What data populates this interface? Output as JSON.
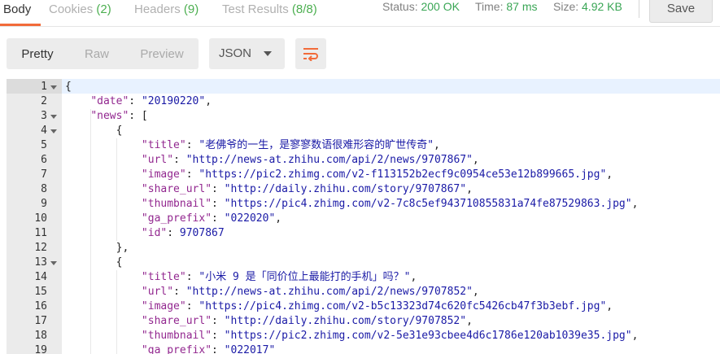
{
  "tabs": [
    {
      "label": "Body",
      "count": ""
    },
    {
      "label": "Cookies",
      "count": "(2)"
    },
    {
      "label": "Headers",
      "count": "(9)"
    },
    {
      "label": "Test Results",
      "count": "(8/8)"
    }
  ],
  "status": {
    "status_label": "Status:",
    "status_value": "200 OK",
    "time_label": "Time:",
    "time_value": "87 ms",
    "size_label": "Size:",
    "size_value": "4.92 KB"
  },
  "save_label": "Save",
  "view_modes": [
    "Pretty",
    "Raw",
    "Preview"
  ],
  "format_select": "JSON",
  "icons": {
    "wrap": "wrap-lines-icon",
    "fold": "fold-arrow-icon"
  },
  "colors": {
    "accent": "#f26b3a",
    "success": "#3aa655",
    "json_key": "#92278f",
    "json_string": "#1a1aa6"
  },
  "code": {
    "line_numbers": [
      "1",
      "2",
      "3",
      "4",
      "5",
      "6",
      "7",
      "8",
      "9",
      "10",
      "11",
      "12",
      "13",
      "14",
      "15",
      "16",
      "17",
      "18",
      "19"
    ],
    "foldable_lines": [
      "1",
      "3",
      "4",
      "13"
    ],
    "lines": [
      {
        "indent": "",
        "parts": [
          {
            "t": "pun",
            "v": "{"
          }
        ]
      },
      {
        "indent": "    ",
        "parts": [
          {
            "t": "key",
            "v": "\"date\""
          },
          {
            "t": "pun",
            "v": ": "
          },
          {
            "t": "str",
            "v": "\"20190220\""
          },
          {
            "t": "pun",
            "v": ","
          }
        ]
      },
      {
        "indent": "    ",
        "parts": [
          {
            "t": "key",
            "v": "\"news\""
          },
          {
            "t": "pun",
            "v": ": ["
          }
        ]
      },
      {
        "indent": "        ",
        "parts": [
          {
            "t": "pun",
            "v": "{"
          }
        ]
      },
      {
        "indent": "            ",
        "parts": [
          {
            "t": "key",
            "v": "\"title\""
          },
          {
            "t": "pun",
            "v": ": "
          },
          {
            "t": "str",
            "v": "\"老佛爷的一生，是寥寥数语很难形容的旷世传奇\""
          },
          {
            "t": "pun",
            "v": ","
          }
        ]
      },
      {
        "indent": "            ",
        "parts": [
          {
            "t": "key",
            "v": "\"url\""
          },
          {
            "t": "pun",
            "v": ": "
          },
          {
            "t": "str",
            "v": "\"http://news-at.zhihu.com/api/2/news/9707867\""
          },
          {
            "t": "pun",
            "v": ","
          }
        ]
      },
      {
        "indent": "            ",
        "parts": [
          {
            "t": "key",
            "v": "\"image\""
          },
          {
            "t": "pun",
            "v": ": "
          },
          {
            "t": "str",
            "v": "\"https://pic2.zhimg.com/v2-f113152b2ecf9c0954ce53e12b899665.jpg\""
          },
          {
            "t": "pun",
            "v": ","
          }
        ]
      },
      {
        "indent": "            ",
        "parts": [
          {
            "t": "key",
            "v": "\"share_url\""
          },
          {
            "t": "pun",
            "v": ": "
          },
          {
            "t": "str",
            "v": "\"http://daily.zhihu.com/story/9707867\""
          },
          {
            "t": "pun",
            "v": ","
          }
        ]
      },
      {
        "indent": "            ",
        "parts": [
          {
            "t": "key",
            "v": "\"thumbnail\""
          },
          {
            "t": "pun",
            "v": ": "
          },
          {
            "t": "str",
            "v": "\"https://pic4.zhimg.com/v2-7c8c5ef943710855831a74fe87529863.jpg\""
          },
          {
            "t": "pun",
            "v": ","
          }
        ]
      },
      {
        "indent": "            ",
        "parts": [
          {
            "t": "key",
            "v": "\"ga_prefix\""
          },
          {
            "t": "pun",
            "v": ": "
          },
          {
            "t": "str",
            "v": "\"022020\""
          },
          {
            "t": "pun",
            "v": ","
          }
        ]
      },
      {
        "indent": "            ",
        "parts": [
          {
            "t": "key",
            "v": "\"id\""
          },
          {
            "t": "pun",
            "v": ": "
          },
          {
            "t": "num",
            "v": "9707867"
          }
        ]
      },
      {
        "indent": "        ",
        "parts": [
          {
            "t": "pun",
            "v": "},"
          }
        ]
      },
      {
        "indent": "        ",
        "parts": [
          {
            "t": "pun",
            "v": "{"
          }
        ]
      },
      {
        "indent": "            ",
        "parts": [
          {
            "t": "key",
            "v": "\"title\""
          },
          {
            "t": "pun",
            "v": ": "
          },
          {
            "t": "str",
            "v": "\"小米 9 是「同价位上最能打的手机」吗？\""
          },
          {
            "t": "pun",
            "v": ","
          }
        ]
      },
      {
        "indent": "            ",
        "parts": [
          {
            "t": "key",
            "v": "\"url\""
          },
          {
            "t": "pun",
            "v": ": "
          },
          {
            "t": "str",
            "v": "\"http://news-at.zhihu.com/api/2/news/9707852\""
          },
          {
            "t": "pun",
            "v": ","
          }
        ]
      },
      {
        "indent": "            ",
        "parts": [
          {
            "t": "key",
            "v": "\"image\""
          },
          {
            "t": "pun",
            "v": ": "
          },
          {
            "t": "str",
            "v": "\"https://pic4.zhimg.com/v2-b5c13323d74c620fc5426cb47f3b3ebf.jpg\""
          },
          {
            "t": "pun",
            "v": ","
          }
        ]
      },
      {
        "indent": "            ",
        "parts": [
          {
            "t": "key",
            "v": "\"share_url\""
          },
          {
            "t": "pun",
            "v": ": "
          },
          {
            "t": "str",
            "v": "\"http://daily.zhihu.com/story/9707852\""
          },
          {
            "t": "pun",
            "v": ","
          }
        ]
      },
      {
        "indent": "            ",
        "parts": [
          {
            "t": "key",
            "v": "\"thumbnail\""
          },
          {
            "t": "pun",
            "v": ": "
          },
          {
            "t": "str",
            "v": "\"https://pic2.zhimg.com/v2-5e31e93cbee4d6c1786e120ab1039e35.jpg\""
          },
          {
            "t": "pun",
            "v": ","
          }
        ]
      },
      {
        "indent": "            ",
        "parts": [
          {
            "t": "key",
            "v": "\"ga_prefix\""
          },
          {
            "t": "pun",
            "v": ": "
          },
          {
            "t": "str",
            "v": "\"022017\""
          }
        ]
      }
    ]
  }
}
